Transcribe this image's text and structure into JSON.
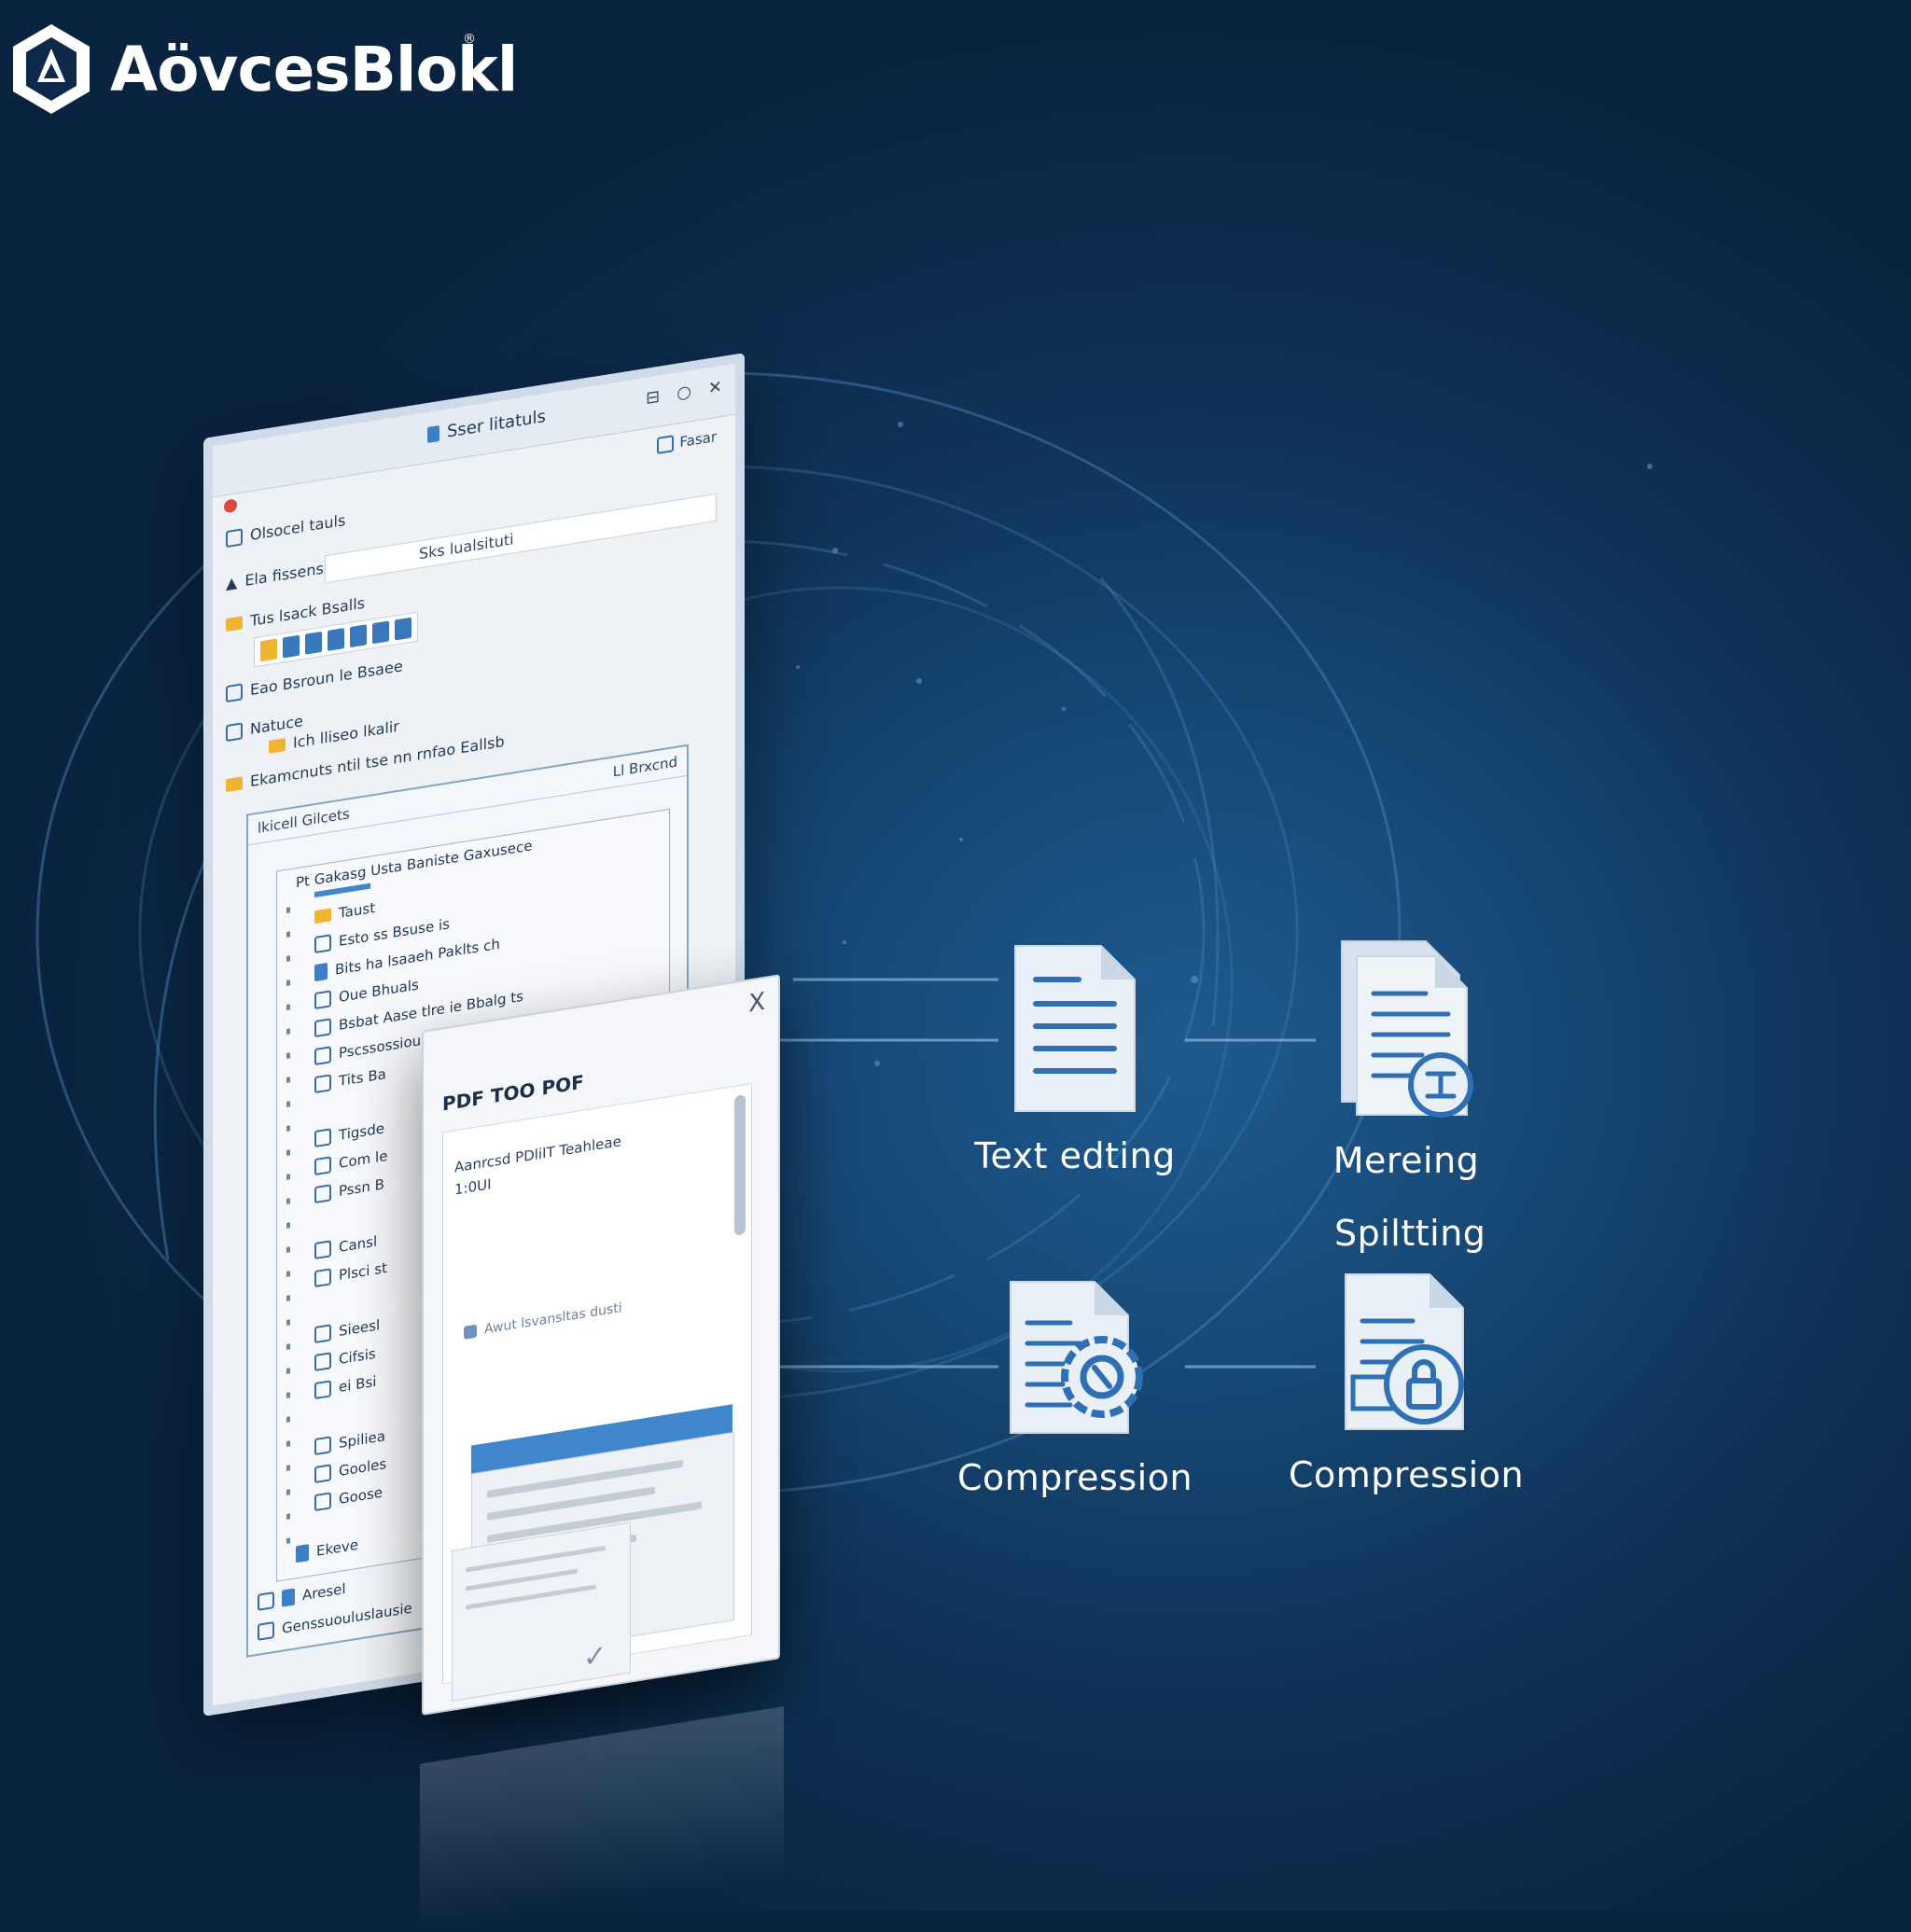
{
  "brand": {
    "name": "AövcesBlokl",
    "tm": "®"
  },
  "main_window": {
    "title": "Sser litatuls",
    "controls": [
      "⊟",
      "○",
      "✕"
    ],
    "toolbar_right": "Fasar",
    "rows": [
      "Olsocel tauls",
      "Ela fissensses",
      "Tus lsack Bsalls",
      "Eao Bsroun le Bsaee",
      "Natuce",
      "Ich lliseo lkalir",
      "Ekamcnuts ntil tse nn rnfao Eallsb"
    ],
    "search_text": "Sks lualsituti",
    "panel": {
      "head_left": "lkicell Gilcets",
      "head_right": "Ll Brxcnd",
      "rows": [
        "Pt Gakasg Usta Baniste Gaxusece",
        "Taust",
        "Esto ss Bsuse is",
        "Bits ha lsaaeh Paklts ch",
        "Oue Bhuals",
        "Bsbat Aase tlre ie Bbalg ts",
        "Pscssossiousaeaoiskutsdas",
        "Tits Ba",
        "Tigsde",
        "Com le",
        "Pssn B",
        "Cansl",
        "Plsci st",
        "Sieesl",
        "Cifsis",
        "ei Bsi",
        "Spiliea",
        "Gooles",
        "Goose",
        "Ekeve",
        "Aresel",
        "Genssuouluslausie"
      ]
    }
  },
  "dialog": {
    "close": "X",
    "title": "PDF TOO POF",
    "line1": "Aanrcsd PDliIT Teahleae",
    "line2": "1:0UI",
    "checkbox": "Awut lsvansltas dusti"
  },
  "features": [
    {
      "id": "text-editing",
      "label": "Text edting",
      "icon": "document-lines-icon"
    },
    {
      "id": "merging",
      "label": "Mereing",
      "icon": "document-merge-icon"
    },
    {
      "id": "compression-1",
      "label": "Compression",
      "icon": "document-gear-icon"
    },
    {
      "id": "compression-2",
      "label": "Compression",
      "icon": "document-lock-icon"
    }
  ],
  "splitting_label": "Spiltting",
  "colors": {
    "background": "#0f3458",
    "accent": "#3f86cc",
    "icon_blue": "#2f6fb3",
    "text": "#ffffff"
  }
}
